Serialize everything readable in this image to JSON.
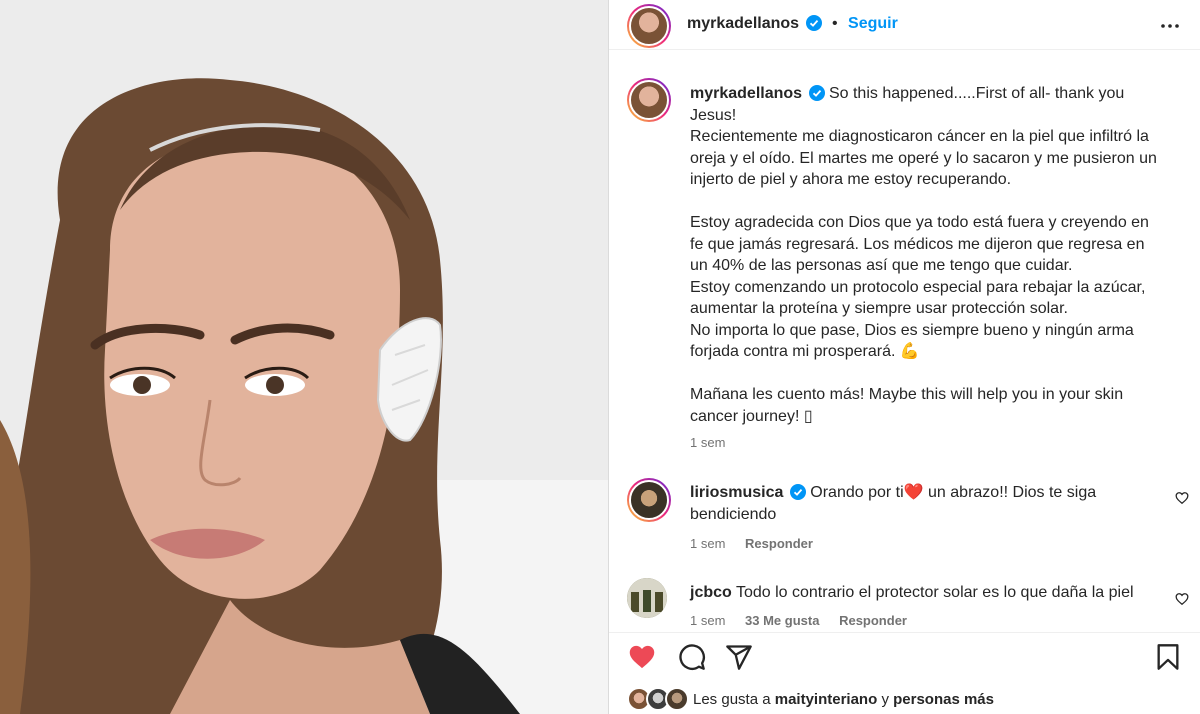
{
  "post": {
    "username": "myrkadellanos",
    "follow_label": "Seguir",
    "separator": "•"
  },
  "caption": {
    "username": "myrkadellanos",
    "lines": [
      "So this happened.....First of all- thank you",
      "Jesus!",
      "Recientemente me diagnosticaron cáncer en la piel que infiltró la",
      "oreja y el oído. El martes me operé y lo sacaron y me pusieron un",
      "injerto de piel y ahora me estoy recuperando.",
      "Estoy agradecida con Dios que ya todo está fuera y creyendo en",
      "fe que jamás regresará. Los médicos me dijeron que regresa en",
      "un 40% de las personas así que me tengo que cuidar.",
      "Estoy comenzando un protocolo especial para rebajar la azúcar,",
      "aumentar la proteína y siempre usar protección solar.",
      "No importa lo que pase, Dios es siempre bueno y ningún arma",
      "forjada contra mi prosperará. 💪",
      "Mañana les cuento más! Maybe this will help you in your skin",
      "cancer journey! ▯"
    ],
    "time": "1 sem"
  },
  "comments": [
    {
      "username": "liriosmusica",
      "text_line1": "Orando por ti❤️ un abrazo!! Dios te siga",
      "text_line2": "bendiciendo",
      "time": "1 sem",
      "reply_label": "Responder"
    },
    {
      "username": "jcbco",
      "text_line1": "Todo lo contrario el protector solar es lo que daña la piel",
      "time": "1 sem",
      "likes": "33 Me gusta",
      "reply_label": "Responder"
    }
  ],
  "actions": {
    "likes_prefix": "Les gusta a",
    "likes_user": "maityinteriano",
    "likes_connector": "y",
    "likes_suffix": "personas más"
  },
  "colors": {
    "accent": "#0095f6",
    "like": "#ed4956",
    "text": "#262626",
    "secondary": "#737373"
  },
  "icons": [
    "verified-badge-icon",
    "more-options-icon",
    "heart-icon",
    "comment-icon",
    "share-icon",
    "bookmark-icon"
  ]
}
